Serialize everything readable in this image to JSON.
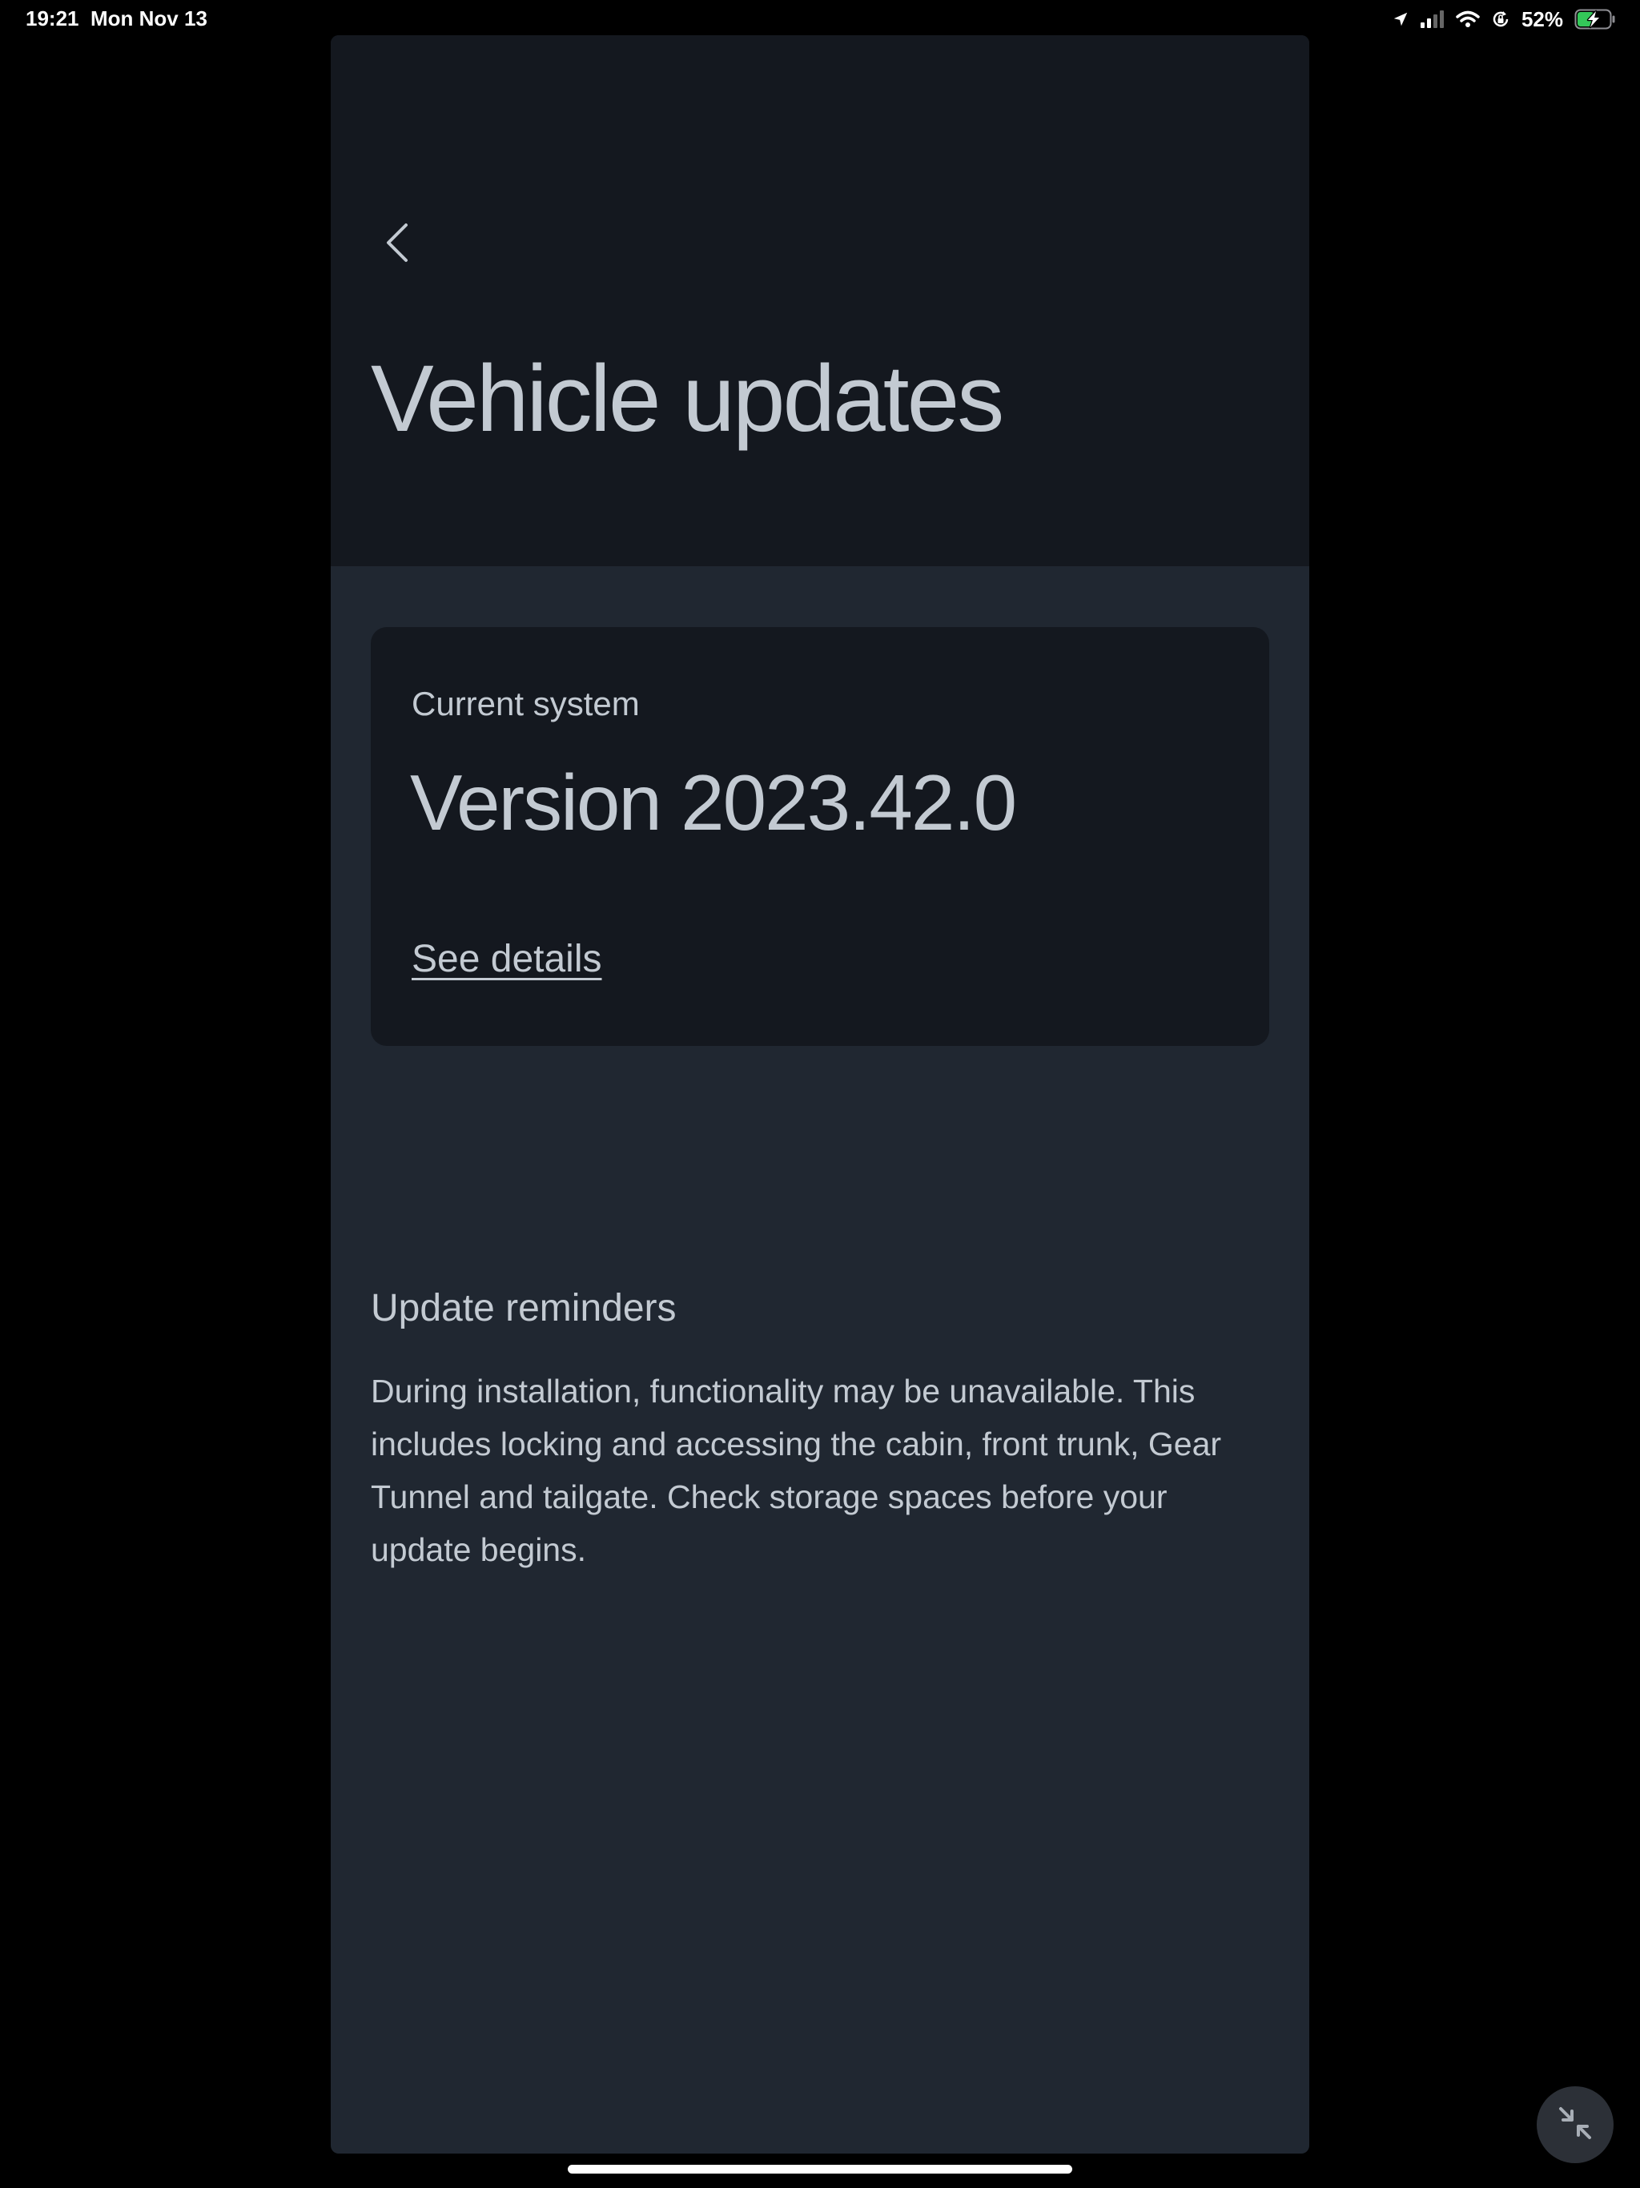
{
  "status_bar": {
    "time": "19:21",
    "date": "Mon Nov 13",
    "battery_percent": "52%",
    "battery_level": 0.52,
    "icons": [
      "location-arrow-icon",
      "cellular-signal-icon",
      "wifi-icon",
      "orientation-lock-icon",
      "battery-charging-icon"
    ]
  },
  "header": {
    "back_icon": "chevron-left-icon",
    "title": "Vehicle updates"
  },
  "current_system": {
    "label": "Current system",
    "version": "Version 2023.42.0",
    "details_link": "See details"
  },
  "reminders": {
    "title": "Update reminders",
    "body": "During installation, functionality may be unavailable. This includes locking and accessing the cabin, front trunk, Gear Tunnel and tailgate. Check storage spaces before your update begins."
  },
  "floating_button": {
    "icon": "minimize-arrows-icon"
  },
  "colors": {
    "background": "#000000",
    "header_bg": "#14181f",
    "content_bg": "#202731",
    "card_bg": "#14181f",
    "text": "#c3cad2",
    "battery_fill": "#34c759"
  }
}
